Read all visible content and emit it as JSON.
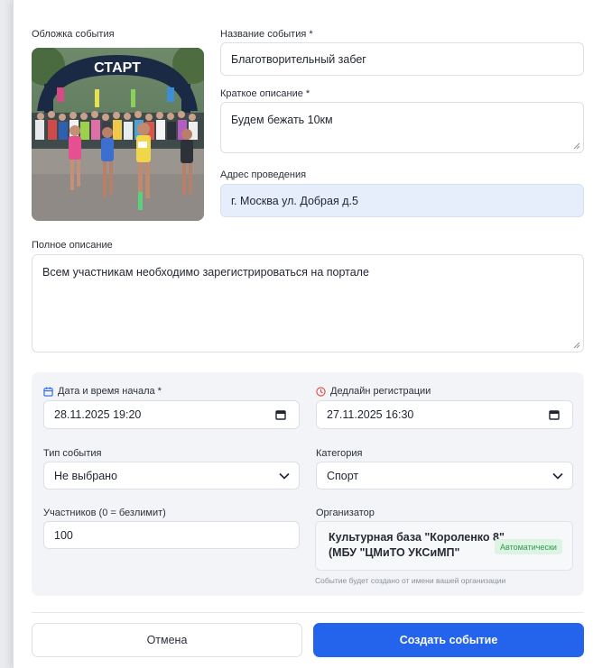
{
  "cover": {
    "label": "Обложка события",
    "image_text": "СТАРТ"
  },
  "title_field": {
    "label": "Название события *",
    "value": "Благотворительный забег"
  },
  "short_desc": {
    "label": "Краткое описание *",
    "value": "Будем бежать 10км"
  },
  "address": {
    "label": "Адрес проведения",
    "value": "г. Москва ул. Добрая д.5"
  },
  "full_desc": {
    "label": "Полное описание",
    "value": "Всем участникам необходимо зарегистрироваться на портале"
  },
  "start": {
    "label": "Дата и время начала *",
    "value": "28.11.2025 19:20",
    "icon": "calendar-icon"
  },
  "deadline": {
    "label": "Дедлайн регистрации",
    "value": "27.11.2025 16:30",
    "icon": "clock-icon"
  },
  "event_type": {
    "label": "Тип события",
    "value": "Не выбрано"
  },
  "category": {
    "label": "Категория",
    "value": "Спорт"
  },
  "participants": {
    "label": "Участников (0 = безлимит)",
    "value": "100"
  },
  "organizer": {
    "label": "Организатор",
    "line1": "Культурная база \"Короленко 8\"",
    "line2": "(МБУ \"ЦМиТО УКСиМП\"",
    "badge": "Автоматически",
    "hint": "Событие будет создано от имени вашей организации"
  },
  "actions": {
    "cancel": "Отмена",
    "submit": "Создать событие"
  },
  "colors": {
    "primary": "#2463eb",
    "badge_bg": "#ddf3e3",
    "badge_text": "#2e9a4c",
    "filled_bg": "#e7eefb"
  }
}
